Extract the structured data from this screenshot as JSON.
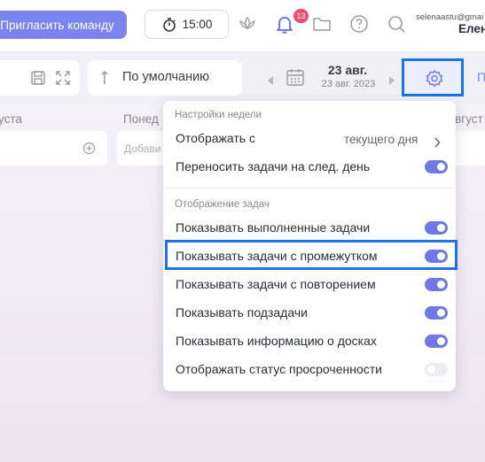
{
  "header": {
    "invite_label": "Пригласить команду",
    "timer_label": "15:00",
    "notifications_count": "13",
    "user_email": "selenaastu@gmai",
    "user_name": "Елен"
  },
  "toolbar": {
    "sort_label": "По умолчанию",
    "date_main": "23 авг.",
    "date_sub": "23 авг. 2023",
    "right_label": "П"
  },
  "columns": {
    "left_title": "уста",
    "middle_title": "Понед",
    "right_title": "вгуст",
    "add_placeholder": "Добави"
  },
  "popup": {
    "week_section_title": "Настройки недели",
    "display_from_label": "Отображать с",
    "display_from_value": "текущего дня",
    "move_tasks_label": "Переносить задачи на след. день",
    "task_section_title": "Отображение задач",
    "rows": [
      {
        "label": "Показывать выполненные задачи",
        "on": true
      },
      {
        "label": "Показывать задачи с промежутком",
        "on": true
      },
      {
        "label": "Показывать задачи с повторением",
        "on": true
      },
      {
        "label": "Показывать подзадачи",
        "on": true
      },
      {
        "label": "Показывать информацию о досках",
        "on": true
      },
      {
        "label": "Отображать статус просроченности",
        "on": false
      }
    ],
    "move_tasks_on": true
  },
  "colors": {
    "accent": "#7b83ee",
    "toggle_on": "#6f78e6",
    "badge": "#ef4f6a",
    "highlight": "#1a73e8"
  }
}
